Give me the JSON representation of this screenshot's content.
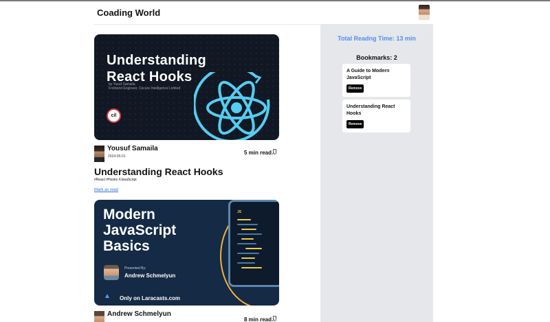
{
  "header": {
    "brand": "Coading World",
    "avatar_icon": "user-avatar"
  },
  "blogs": [
    {
      "cover": {
        "title_line1": "Understanding",
        "title_line2": "React Hooks",
        "by_line1": "by Yusuf Samaila",
        "by_line2": "Frontend Engineer, Cecure Intelligence Limited",
        "logo_text": "cil"
      },
      "author": "Yousuf Samaila",
      "date": "2024-05-01",
      "read_time": "5 min read",
      "title": "Understanding React Hooks",
      "tags": "#React #Hooks #JavaScript",
      "mark_as_read": "Mark as read"
    },
    {
      "cover": {
        "title_line1": "Modern",
        "title_line2": "JavaScript",
        "title_line3": "Basics",
        "presented_by": "Presented By:",
        "presenter": "Andrew Schmelyun",
        "only_on": "Only on Laracasts.com",
        "phone_label": "JS"
      },
      "author": "Andrew Schmelyun",
      "read_time": "8 min read"
    }
  ],
  "sidebar": {
    "total_reading_time": "Total Readng Time: 13 min",
    "bookmarks_heading": "Bookmarks: 2",
    "bookmarks": [
      {
        "title": "A Guide to Modern JavaScript",
        "remove": "Remove"
      },
      {
        "title": "Understanding React Hooks",
        "remove": "Remove"
      }
    ]
  },
  "colors": {
    "accent": "#4f8ef0",
    "sidebar_bg": "#e5e7eb",
    "react_cyan": "#55cdf0",
    "js_yellow": "#f2c94c"
  }
}
